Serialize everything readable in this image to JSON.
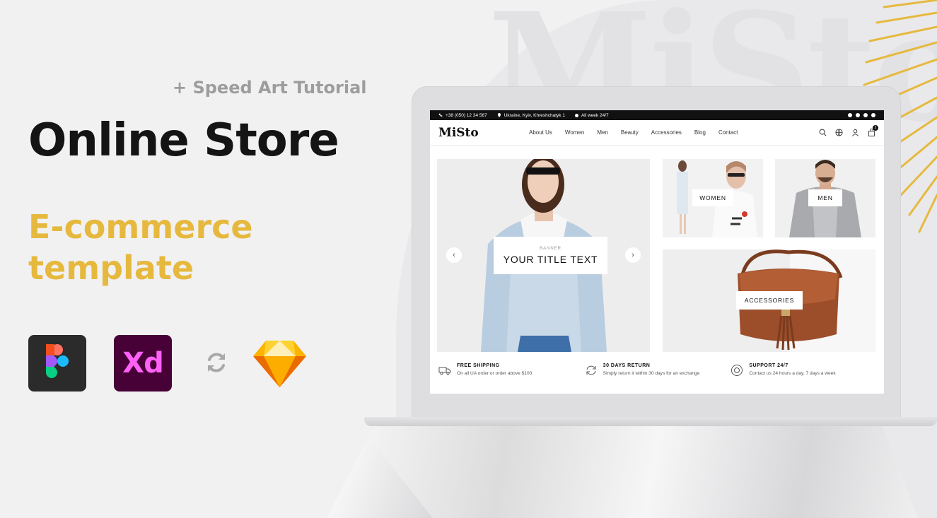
{
  "hero": {
    "subtitle": "+ Speed Art Tutorial",
    "title": "Online Store",
    "accent_line1": "E-commerce",
    "accent_line2": "template"
  },
  "background": {
    "watermark": "MiSto"
  },
  "tools": {
    "figma": "figma-logo",
    "xd_label": "Xd",
    "sync": "sync-icon",
    "sketch": "sketch-logo"
  },
  "colors": {
    "accent": "#e6b93e",
    "dark": "#141414",
    "muted": "#9d9d9d",
    "xd_bg": "#470137",
    "xd_fg": "#ff61f6"
  },
  "store": {
    "topbar": {
      "phone": "+38 (050) 12 34 567",
      "location": "Ukraine, Kyiv, Khreshchatyk 1",
      "hours": "All week 24/7"
    },
    "logo": "MiSto",
    "nav": [
      "About Us",
      "Women",
      "Men",
      "Beauty",
      "Accessories",
      "Blog",
      "Contact"
    ],
    "cart_count": "2",
    "banner": {
      "kicker": "BANNER",
      "title": "YOUR TITLE TEXT",
      "prev": "‹",
      "next": "›"
    },
    "tiles": {
      "women": "WOMEN",
      "men": "MEN",
      "accessories": "ACCESSORIES"
    },
    "features": [
      {
        "title": "FREE SHIPPING",
        "text": "On all UA order or order above $100"
      },
      {
        "title": "30 DAYS RETURN",
        "text": "Simply return it within 30 days for an exchange"
      },
      {
        "title": "SUPPORT 24/7",
        "text": "Contact us 24 hours a day, 7 days a week"
      }
    ]
  }
}
